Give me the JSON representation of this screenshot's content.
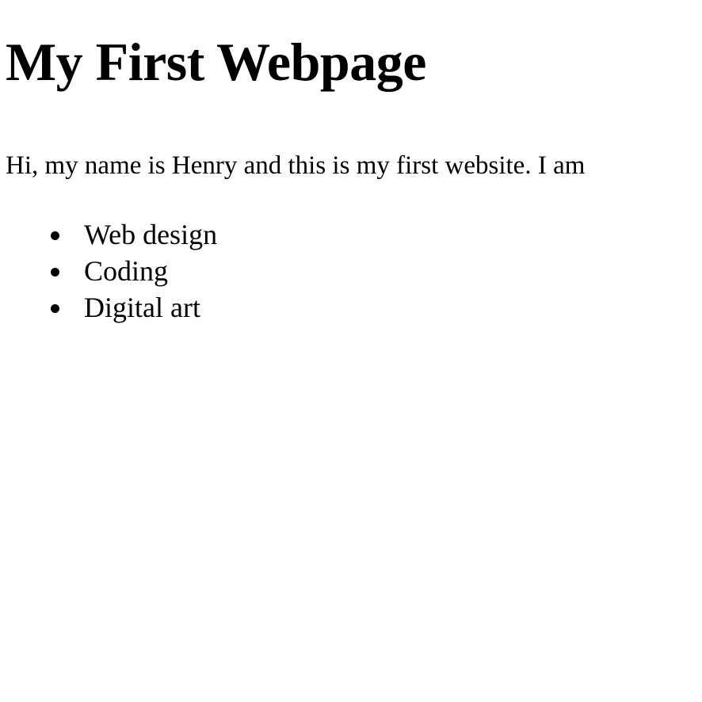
{
  "page": {
    "title": "My First Webpage",
    "intro": "Hi, my name is Henry and this is my first website. I am",
    "interests": [
      "Web design",
      "Coding",
      "Digital art"
    ]
  }
}
